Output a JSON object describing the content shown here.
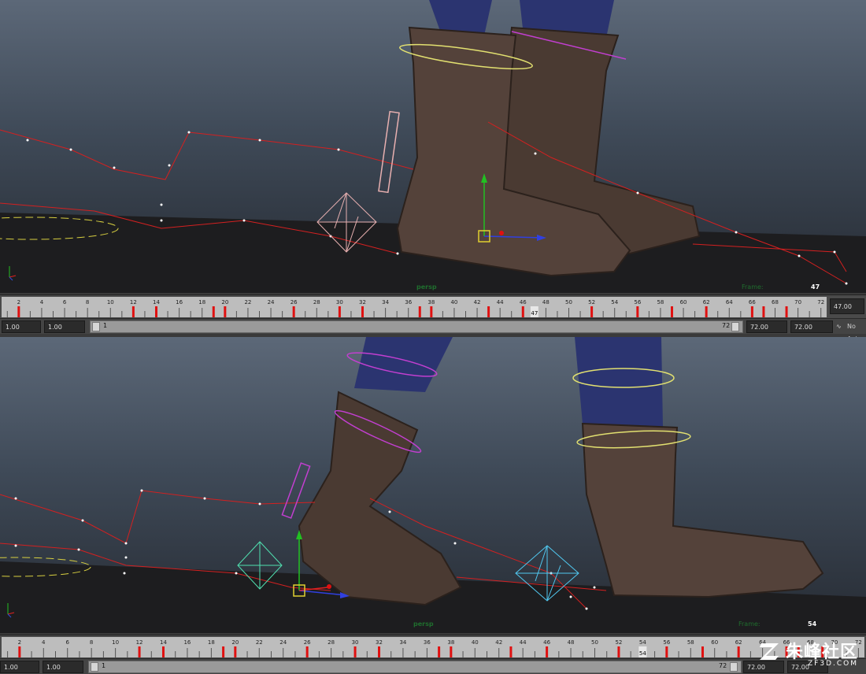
{
  "top_viewport": {
    "camera": "persp",
    "frame_label": "Frame:",
    "frame_value": "47"
  },
  "top_timeslider": {
    "tick_labels": [
      "2",
      "4",
      "6",
      "8",
      "10",
      "12",
      "14",
      "16",
      "18",
      "20",
      "22",
      "24",
      "26",
      "28",
      "30",
      "32",
      "34",
      "36",
      "38",
      "40",
      "42",
      "44",
      "46",
      "48",
      "50",
      "52",
      "54",
      "56",
      "58",
      "60",
      "62",
      "64",
      "66",
      "68",
      "70",
      "72"
    ],
    "current_marker": "47",
    "current_time": "47.00"
  },
  "top_rangebar": {
    "start_time": "1.00",
    "playback_start": "1.00",
    "range_start": "1",
    "range_end": "72",
    "playback_end": "72.00",
    "end_time": "72.00",
    "anim_layer": "No Anim"
  },
  "bottom_viewport": {
    "camera": "persp",
    "frame_label": "Frame:",
    "frame_value": "54"
  },
  "bottom_timeslider": {
    "tick_labels": [
      "2",
      "4",
      "6",
      "8",
      "10",
      "12",
      "14",
      "16",
      "18",
      "20",
      "22",
      "24",
      "26",
      "28",
      "30",
      "32",
      "34",
      "36",
      "38",
      "40",
      "42",
      "44",
      "46",
      "48",
      "50",
      "52",
      "54",
      "56",
      "58",
      "60",
      "62",
      "64",
      "66",
      "68",
      "70",
      "72"
    ],
    "current_marker": "54"
  },
  "bottom_rangebar": {
    "start_time": "1.00",
    "playback_start": "1.00",
    "range_start": "1",
    "range_end": "72",
    "playback_end": "72.00",
    "end_time": "72.00"
  },
  "watermark": {
    "text_cn": "朱峰社区",
    "text_en": "ZF3D.COM"
  },
  "colors": {
    "boot": "#4a3a32",
    "pants": "#2b3470",
    "motion_trail": "#d42020",
    "key_tick": "#e01010"
  }
}
